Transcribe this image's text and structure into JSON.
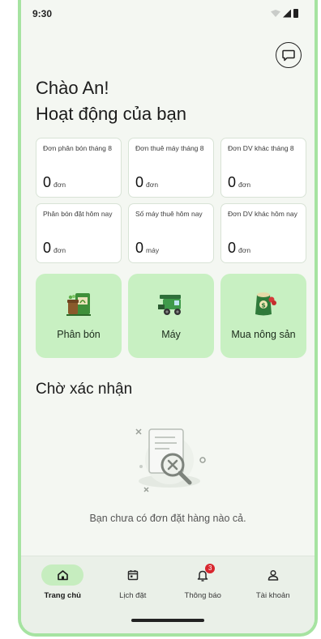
{
  "status_bar": {
    "time": "9:30"
  },
  "header": {
    "greeting": "Chào An!",
    "title": "Hoạt động của bạn"
  },
  "stats": [
    {
      "label": "Đơn phân bón tháng 8",
      "value": "0",
      "unit": "đơn"
    },
    {
      "label": "Đơn thuê máy tháng 8",
      "value": "0",
      "unit": "đơn"
    },
    {
      "label": "Đơn DV khác tháng 8",
      "value": "0",
      "unit": "đơn"
    },
    {
      "label": "Phân bón đặt hôm nay",
      "value": "0",
      "unit": "đơn"
    },
    {
      "label": "Số máy thuê hôm nay",
      "value": "0",
      "unit": "máy"
    },
    {
      "label": "Đơn DV khác hôm nay",
      "value": "0",
      "unit": "đơn"
    }
  ],
  "services": [
    {
      "label": "Phân bón",
      "icon": "fertilizer-icon"
    },
    {
      "label": "Máy",
      "icon": "harvester-icon"
    },
    {
      "label": "Mua nông sản",
      "icon": "produce-bag-icon"
    }
  ],
  "pending": {
    "title": "Chờ xác nhận",
    "empty_message": "Bạn chưa có đơn đặt hàng nào cả."
  },
  "bottom_nav": {
    "items": [
      {
        "label": "Trang chủ",
        "icon": "home-icon",
        "active": true
      },
      {
        "label": "Lịch đặt",
        "icon": "calendar-icon",
        "active": false
      },
      {
        "label": "Thông báo",
        "icon": "bell-icon",
        "active": false,
        "badge": "3"
      },
      {
        "label": "Tài khoản",
        "icon": "user-icon",
        "active": false
      }
    ]
  },
  "colors": {
    "accent": "#c8f0c2",
    "frame": "#a6e3a1",
    "badge": "#d8262e",
    "background": "#f4f7f2"
  }
}
